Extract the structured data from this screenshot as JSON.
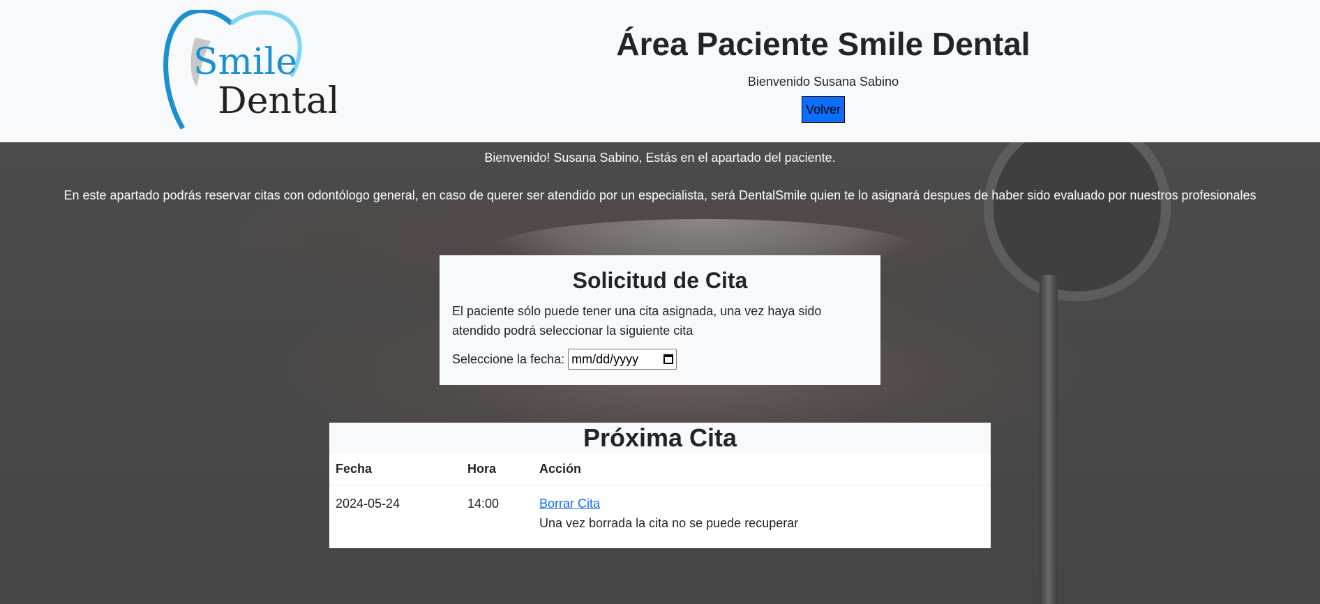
{
  "header": {
    "logo": {
      "line1": "Smile",
      "line2": "Dental"
    },
    "title": "Área Paciente Smile Dental",
    "welcome": "Bienvenido Susana Sabino",
    "back_label": "Volver"
  },
  "intro": {
    "line1": "Bienvenido! Susana Sabino, Estás en el apartado del paciente.",
    "line2": "En este apartado podrás reservar citas con odontólogo general, en caso de querer ser atendido por un especialista, será DentalSmile quien te lo asignará despues de haber sido evaluado por nuestros profesionales"
  },
  "request": {
    "title": "Solicitud de Cita",
    "note": "El paciente sólo puede tener una cita asignada, una vez haya sido atendido podrá seleccionar la siguiente cita",
    "date_label": "Seleccione la fecha:",
    "date_placeholder": "mm/dd/yyyy",
    "calendar_icon": "calendar-icon"
  },
  "next": {
    "title": "Próxima Cita",
    "headers": [
      "Fecha",
      "Hora",
      "Acción"
    ],
    "rows": [
      {
        "fecha": "2024-05-24",
        "hora": "14:00",
        "action_link": "Borrar Cita",
        "action_note": "Una vez borrada la cita no se puede recuperar"
      }
    ]
  },
  "colors": {
    "accent": "#0d6efd",
    "logo_blue": "#1a8fd1",
    "logo_light": "#7fd6f5"
  }
}
